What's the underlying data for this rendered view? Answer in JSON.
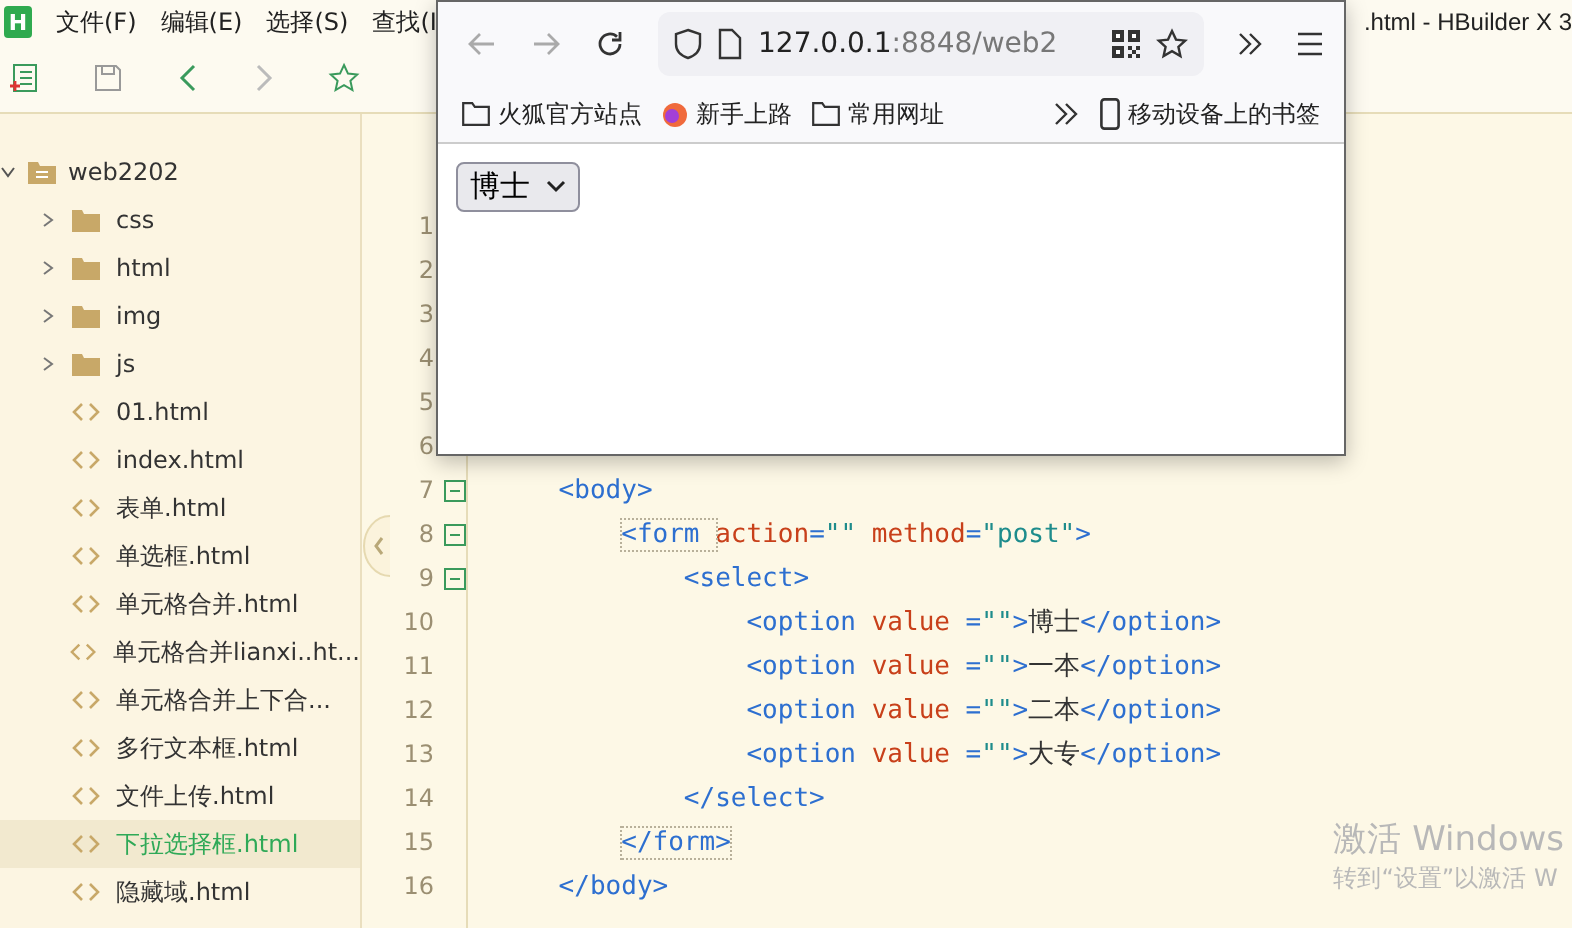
{
  "ide": {
    "app_badge": "H",
    "menu": [
      "文件(F)",
      "编辑(E)",
      "选择(S)",
      "查找(I"
    ],
    "title": ".html - HBuilder X 3",
    "project": {
      "label": "web2202",
      "expanded": true,
      "children": [
        {
          "label": "css",
          "kind": "folder",
          "expanded": false,
          "selected": false
        },
        {
          "label": "html",
          "kind": "folder",
          "expanded": false,
          "selected": false
        },
        {
          "label": "img",
          "kind": "folder",
          "expanded": false,
          "selected": false
        },
        {
          "label": "js",
          "kind": "folder",
          "expanded": false,
          "selected": false
        },
        {
          "label": "01.html",
          "kind": "file",
          "selected": false
        },
        {
          "label": "index.html",
          "kind": "file",
          "selected": false
        },
        {
          "label": "表单.html",
          "kind": "file",
          "selected": false
        },
        {
          "label": "单选框.html",
          "kind": "file",
          "selected": false
        },
        {
          "label": "单元格合并.html",
          "kind": "file",
          "selected": false
        },
        {
          "label": "单元格合并lianxi..ht...",
          "kind": "file",
          "selected": false
        },
        {
          "label": "单元格合并上下合...",
          "kind": "file",
          "selected": false
        },
        {
          "label": "多行文本框.html",
          "kind": "file",
          "selected": false
        },
        {
          "label": "文件上传.html",
          "kind": "file",
          "selected": false
        },
        {
          "label": "下拉选择框.html",
          "kind": "file",
          "selected": true
        },
        {
          "label": "隐藏域.html",
          "kind": "file",
          "selected": false
        }
      ]
    },
    "code_lines": [
      {
        "number": "1",
        "fold": false
      },
      {
        "number": "2",
        "fold": false
      },
      {
        "number": "3",
        "fold": false
      },
      {
        "number": "4",
        "fold": false
      },
      {
        "number": "5",
        "fold": false
      },
      {
        "number": "6",
        "fold": false
      },
      {
        "number": "7",
        "fold": true,
        "tokens": [
          {
            "kind": "tag",
            "text": "    <body>"
          }
        ]
      },
      {
        "number": "8",
        "fold": true,
        "tokens": [
          {
            "kind": "match",
            "text": "        <form "
          },
          {
            "kind": "attr",
            "text": "action"
          },
          {
            "kind": "tag",
            "text": "="
          },
          {
            "kind": "str",
            "text": "\"\" "
          },
          {
            "kind": "attr",
            "text": "method"
          },
          {
            "kind": "tag",
            "text": "="
          },
          {
            "kind": "str",
            "text": "\"post\""
          },
          {
            "kind": "tag",
            "text": ">"
          }
        ]
      },
      {
        "number": "9",
        "fold": true,
        "tokens": [
          {
            "kind": "tag",
            "text": "            <select>"
          }
        ]
      },
      {
        "number": "10",
        "fold": false,
        "tokens": [
          {
            "kind": "tag",
            "text": "                <option "
          },
          {
            "kind": "attr",
            "text": "value"
          },
          {
            "kind": "tag",
            "text": " ="
          },
          {
            "kind": "str",
            "text": "\"\""
          },
          {
            "kind": "tag",
            "text": ">"
          },
          {
            "kind": "text",
            "text": "博士"
          },
          {
            "kind": "tag",
            "text": "</option>"
          }
        ]
      },
      {
        "number": "11",
        "fold": false,
        "tokens": [
          {
            "kind": "tag",
            "text": "                <option "
          },
          {
            "kind": "attr",
            "text": "value"
          },
          {
            "kind": "tag",
            "text": " ="
          },
          {
            "kind": "str",
            "text": "\"\""
          },
          {
            "kind": "tag",
            "text": ">"
          },
          {
            "kind": "text",
            "text": "一本"
          },
          {
            "kind": "tag",
            "text": "</option>"
          }
        ]
      },
      {
        "number": "12",
        "fold": false,
        "tokens": [
          {
            "kind": "tag",
            "text": "                <option "
          },
          {
            "kind": "attr",
            "text": "value"
          },
          {
            "kind": "tag",
            "text": " ="
          },
          {
            "kind": "str",
            "text": "\"\""
          },
          {
            "kind": "tag",
            "text": ">"
          },
          {
            "kind": "text",
            "text": "二本"
          },
          {
            "kind": "tag",
            "text": "</option>"
          }
        ]
      },
      {
        "number": "13",
        "fold": false,
        "tokens": [
          {
            "kind": "tag",
            "text": "                <option "
          },
          {
            "kind": "attr",
            "text": "value"
          },
          {
            "kind": "tag",
            "text": " ="
          },
          {
            "kind": "str",
            "text": "\"\""
          },
          {
            "kind": "tag",
            "text": ">"
          },
          {
            "kind": "text",
            "text": "大专"
          },
          {
            "kind": "tag",
            "text": "</option>"
          }
        ]
      },
      {
        "number": "14",
        "fold": false,
        "tokens": [
          {
            "kind": "tag",
            "text": "            </select>"
          }
        ]
      },
      {
        "number": "15",
        "fold": false,
        "tokens": [
          {
            "kind": "match",
            "text": "        </form>"
          }
        ]
      },
      {
        "number": "16",
        "fold": false,
        "tokens": [
          {
            "kind": "tag",
            "text": "    </body>"
          }
        ]
      }
    ]
  },
  "browser": {
    "url_host": "127.0.0.1",
    "url_rest": ":8848/web2",
    "bookmarks": [
      {
        "label": "火狐官方站点",
        "kind": "folder"
      },
      {
        "label": "新手上路",
        "kind": "globe"
      },
      {
        "label": "常用网址",
        "kind": "folder"
      }
    ],
    "mobile_bookmarks": "移动设备上的书签",
    "select": {
      "value": "博士"
    }
  },
  "os_notice": [
    "激活 Windows",
    "转到“设置”以激活 W"
  ]
}
